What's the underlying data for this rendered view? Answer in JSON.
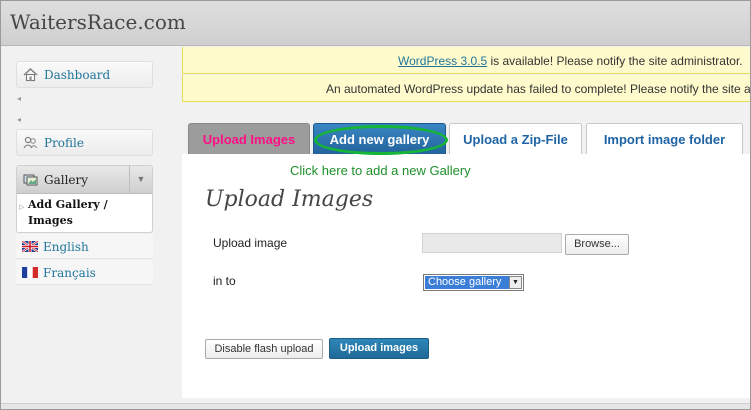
{
  "site": {
    "title": "WaitersRace.com"
  },
  "sidebar": {
    "dashboard": "Dashboard",
    "profile": "Profile",
    "gallery": "Gallery",
    "submenu_line1": "Add Gallery /",
    "submenu_line2": "Images",
    "lang_english": "English",
    "lang_french": "Français"
  },
  "notices": {
    "update_link": "WordPress 3.0.5",
    "update_text": " is available! Please notify the site administrator.",
    "failed_update": "An automated WordPress update has failed to complete! Please notify the site administrator."
  },
  "tabs": {
    "upload": "Upload Images",
    "add_gallery": "Add new gallery",
    "zip": "Upload a Zip-File",
    "import_folder": "Import image folder"
  },
  "hint": "Click here to add a new Gallery",
  "form": {
    "heading": "Upload Images",
    "upload_label": "Upload image",
    "browse": "Browse...",
    "into_label": "in to",
    "gallery_select": "Choose gallery",
    "disable_flash": "Disable flash upload",
    "upload_button": "Upload images"
  },
  "colors": {
    "link": "#21759b",
    "notice_bg": "#fffbcc",
    "active_tab": "#23649c",
    "highlight_oval": "#15b538",
    "upload_tab_text": "#ff0f86"
  }
}
